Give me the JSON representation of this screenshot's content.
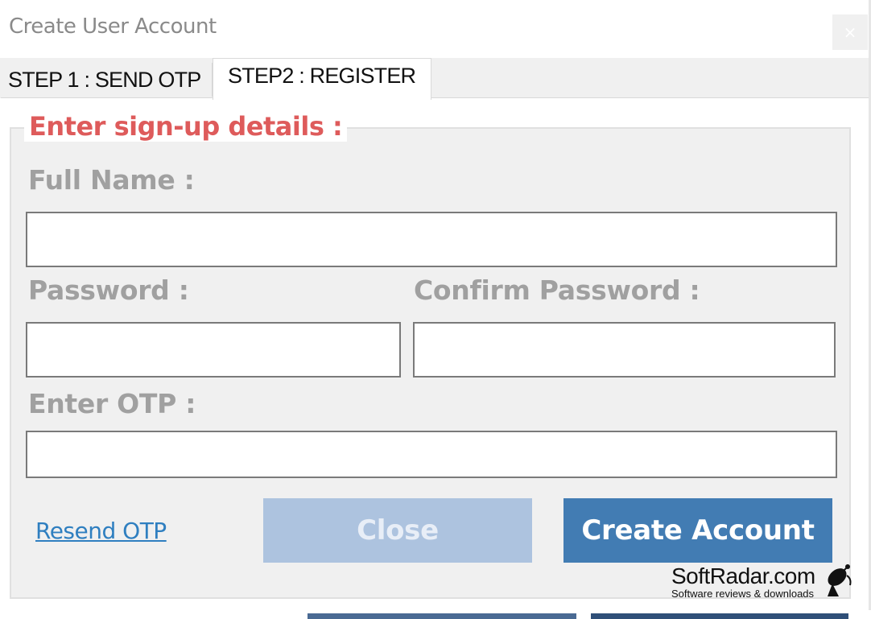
{
  "window": {
    "title": "Create User Account",
    "close_glyph": "×"
  },
  "tabs": [
    {
      "label": "STEP 1 : SEND OTP",
      "active": false
    },
    {
      "label": "STEP2 : REGISTER",
      "active": true
    }
  ],
  "form": {
    "legend": "Enter sign-up details :",
    "full_name_label": "Full Name :",
    "full_name_value": "",
    "password_label": "Password :",
    "password_value": "",
    "confirm_password_label": "Confirm Password :",
    "confirm_password_value": "",
    "otp_label": "Enter OTP :",
    "otp_value": ""
  },
  "actions": {
    "resend_otp": "Resend OTP",
    "close": "Close",
    "create_account": "Create Account"
  },
  "watermark": {
    "brand": "SoftRadar.com",
    "tagline": "Software reviews & downloads",
    "icon": "satellite-dish-icon"
  },
  "colors": {
    "legend": "#de5b5b",
    "labels": "#a0a0a0",
    "link": "#2f7fc0",
    "primary_button": "#427cb3",
    "disabled_button": "#adc3df"
  }
}
